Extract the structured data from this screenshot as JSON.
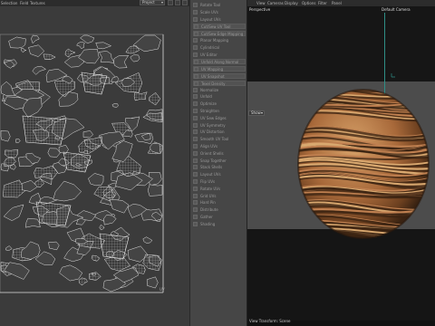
{
  "uv_editor": {
    "menu": [
      "Selection",
      "Field",
      "Textures"
    ],
    "dropdown_value": "Project",
    "scale_label": "UV"
  },
  "attr_panel": {
    "rows": [
      {
        "label": "Rotate Tool",
        "boxed": false
      },
      {
        "label": "Scale UVs",
        "boxed": false
      },
      {
        "label": "Layout UVs",
        "boxed": false
      },
      {
        "label": "Cut/Sew UV Tool",
        "boxed": true
      },
      {
        "label": "Cut/Sew Edge Mapping",
        "boxed": true
      },
      {
        "label": "Planar Mapping",
        "boxed": false
      },
      {
        "label": "Cylindrical",
        "boxed": false
      },
      {
        "label": "UV Editor",
        "boxed": false
      },
      {
        "label": "Unfold Along Normal",
        "boxed": true
      },
      {
        "label": "UV Mapping",
        "boxed": true
      },
      {
        "label": "UV Snapshot",
        "boxed": true
      },
      {
        "label": "Texel Density",
        "boxed": true
      },
      {
        "label": "Normalize",
        "boxed": false
      },
      {
        "label": "Unfold",
        "boxed": false
      },
      {
        "label": "Optimize",
        "boxed": false
      },
      {
        "label": "Straighten",
        "boxed": false
      },
      {
        "label": "UV Sew Edges",
        "boxed": false
      },
      {
        "label": "UV Symmetry",
        "boxed": false
      },
      {
        "label": "UV Distortion",
        "boxed": false
      },
      {
        "label": "Smooth UV Tool",
        "boxed": false
      },
      {
        "label": "Align UVs",
        "boxed": false
      },
      {
        "label": "Orient Shells",
        "boxed": false
      },
      {
        "label": "Snap Together",
        "boxed": false
      },
      {
        "label": "Stack Shells",
        "boxed": false
      },
      {
        "label": "Layout UVs",
        "boxed": false
      },
      {
        "label": "Flip UVs",
        "boxed": false
      },
      {
        "label": "Rotate UVs",
        "boxed": false
      },
      {
        "label": "Grid UVs",
        "boxed": false
      },
      {
        "label": "Hard Pin",
        "boxed": false
      },
      {
        "label": "Distribute",
        "boxed": false
      },
      {
        "label": "Gather",
        "boxed": false
      },
      {
        "label": "Shading",
        "boxed": false
      }
    ]
  },
  "viewport": {
    "menu": [
      "View",
      "Cameras",
      "Display",
      "Options",
      "Filter",
      "Panel"
    ],
    "perspective_label": "Perspective",
    "camera_label": "Default Camera",
    "show_label": "Show",
    "status_text": "View Transform: Scene"
  },
  "colors": {
    "axis": "#2f8f86",
    "wood_light": "#c8915a",
    "wood_dark": "#3a2312"
  }
}
